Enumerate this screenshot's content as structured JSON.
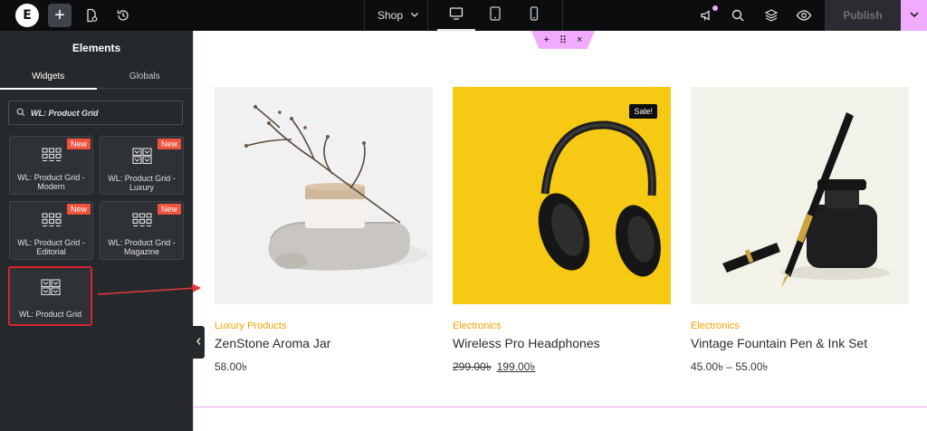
{
  "topbar": {
    "logo": "E",
    "add_symbol": "+",
    "page_name": "Shop",
    "publish_label": "Publish",
    "icons": [
      "elementor-logo-icon",
      "plus-icon",
      "page-settings-icon",
      "history-icon",
      "chevron-down-icon",
      "desktop-icon",
      "tablet-icon",
      "mobile-icon",
      "announcement-icon",
      "search-icon",
      "layers-icon",
      "eye-icon",
      "chevron-down-icon"
    ]
  },
  "panel": {
    "title": "Elements",
    "tabs": [
      "Widgets",
      "Globals"
    ],
    "search_value": "WL: Product Grid",
    "widgets": [
      {
        "label": "WL: Product Grid - Modern",
        "badge": "New"
      },
      {
        "label": "WL: Product Grid - Luxury",
        "badge": "New"
      },
      {
        "label": "WL: Product Grid - Editorial",
        "badge": "New"
      },
      {
        "label": "WL: Product Grid - Magazine",
        "badge": "New"
      },
      {
        "label": "WL: Product Grid",
        "badge": ""
      }
    ]
  },
  "section_controls": [
    "+",
    "⠿",
    "×"
  ],
  "products": [
    {
      "category": "Luxury Products",
      "name": "ZenStone Aroma Jar",
      "price": "58.00৳",
      "old_price": "",
      "sale_price": "",
      "badge": ""
    },
    {
      "category": "Electronics",
      "name": "Wireless Pro Headphones",
      "price": "",
      "old_price": "299.00৳",
      "sale_price": "199.00৳",
      "badge": "Sale!"
    },
    {
      "category": "Electronics",
      "name": "Vintage Fountain Pen & Ink Set",
      "price": "45.00৳ – 55.00৳",
      "old_price": "",
      "sale_price": "",
      "badge": ""
    }
  ],
  "colors": {
    "topbar_bg": "#0c0d0e",
    "panel_bg": "#26292c",
    "accent_pink": "#f0abfc",
    "category_orange": "#f0a500",
    "new_badge": "#f0523c",
    "highlight_red": "#d9232e",
    "headphones_bg": "#f6c915"
  }
}
